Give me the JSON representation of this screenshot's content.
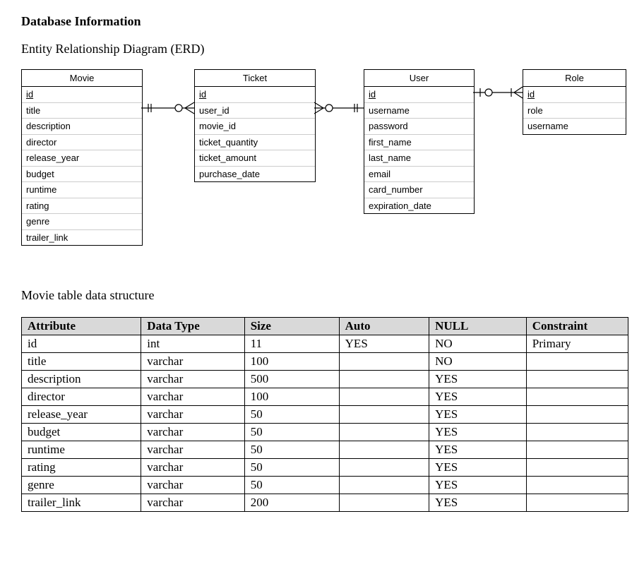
{
  "doc": {
    "title": "Database Information",
    "erd_subtitle": "Entity Relationship Diagram (ERD)",
    "table_title": "Movie table data structure"
  },
  "entities": {
    "movie": {
      "name": "Movie",
      "attrs": [
        "id",
        "title",
        "description",
        "director",
        "release_year",
        "budget",
        "runtime",
        "rating",
        "genre",
        "trailer_link"
      ]
    },
    "ticket": {
      "name": "Ticket",
      "attrs": [
        "id",
        "user_id",
        "movie_id",
        "ticket_quantity",
        "ticket_amount",
        "purchase_date"
      ]
    },
    "user": {
      "name": "User",
      "attrs": [
        "id",
        "username",
        "password",
        "first_name",
        "last_name",
        "email",
        "card_number",
        "expiration_date"
      ]
    },
    "role": {
      "name": "Role",
      "attrs": [
        "id",
        "role",
        "username"
      ]
    }
  },
  "relationships": [
    {
      "from": "Movie",
      "to": "Ticket",
      "from_card": "one",
      "to_card": "zero-or-many"
    },
    {
      "from": "Ticket",
      "to": "User",
      "from_card": "zero-or-many",
      "to_card": "one"
    },
    {
      "from": "User",
      "to": "Role",
      "from_card": "one-and-only-one",
      "to_card": "one-or-many"
    }
  ],
  "schema_table": {
    "headers": [
      "Attribute",
      "Data Type",
      "Size",
      "Auto",
      "NULL",
      "Constraint"
    ],
    "rows": [
      {
        "attr": "id",
        "type": "int",
        "size": "11",
        "auto": "YES",
        "null": "NO",
        "constraint": "Primary"
      },
      {
        "attr": "title",
        "type": "varchar",
        "size": "100",
        "auto": "",
        "null": "NO",
        "constraint": ""
      },
      {
        "attr": "description",
        "type": "varchar",
        "size": "500",
        "auto": "",
        "null": "YES",
        "constraint": ""
      },
      {
        "attr": "director",
        "type": "varchar",
        "size": "100",
        "auto": "",
        "null": "YES",
        "constraint": ""
      },
      {
        "attr": "release_year",
        "type": "varchar",
        "size": "50",
        "auto": "",
        "null": "YES",
        "constraint": ""
      },
      {
        "attr": "budget",
        "type": "varchar",
        "size": "50",
        "auto": "",
        "null": "YES",
        "constraint": ""
      },
      {
        "attr": "runtime",
        "type": "varchar",
        "size": "50",
        "auto": "",
        "null": "YES",
        "constraint": ""
      },
      {
        "attr": "rating",
        "type": "varchar",
        "size": "50",
        "auto": "",
        "null": "YES",
        "constraint": ""
      },
      {
        "attr": "genre",
        "type": "varchar",
        "size": "50",
        "auto": "",
        "null": "YES",
        "constraint": ""
      },
      {
        "attr": "trailer_link",
        "type": "varchar",
        "size": "200",
        "auto": "",
        "null": "YES",
        "constraint": ""
      }
    ]
  }
}
